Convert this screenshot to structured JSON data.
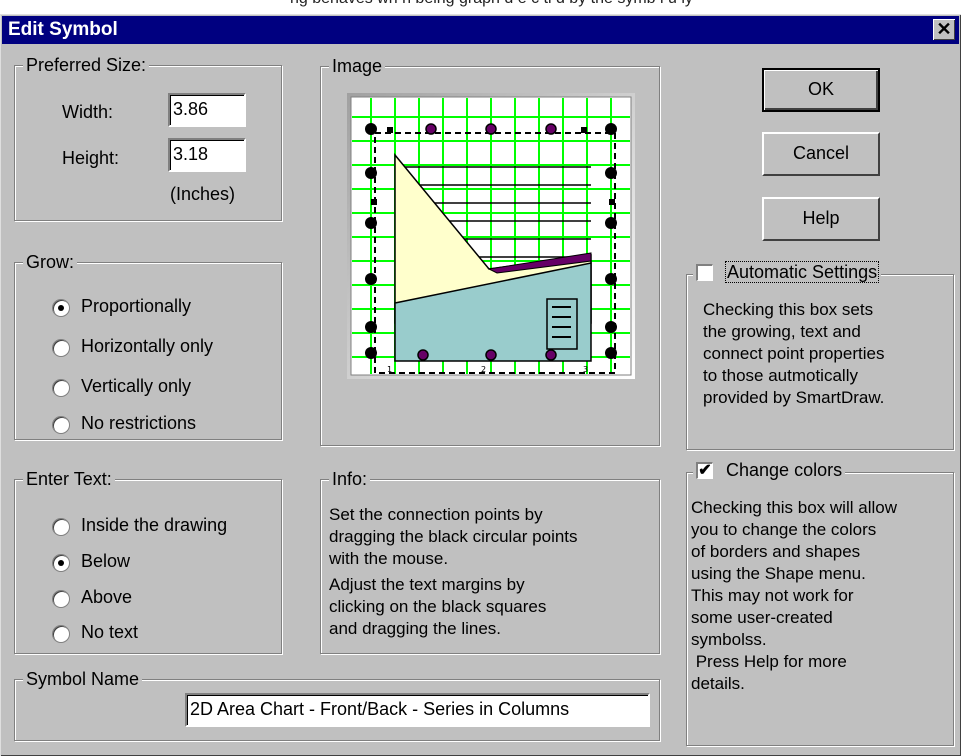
{
  "background_text": "ng behaves wh n being graph d          e     c ti     d by the symb l     u   ly",
  "window": {
    "title": "Edit Symbol",
    "close": "✕"
  },
  "preferred_size": {
    "legend": "Preferred Size:",
    "width_label": "Width:",
    "width_value": "3.86",
    "height_label": "Height:",
    "height_value": "3.18",
    "units": "(Inches)"
  },
  "grow": {
    "legend": "Grow:",
    "options": [
      {
        "label": "Proportionally",
        "selected": true
      },
      {
        "label": "Horizontally only",
        "selected": false
      },
      {
        "label": "Vertically only",
        "selected": false
      },
      {
        "label": "No restrictions",
        "selected": false
      }
    ]
  },
  "enter_text": {
    "legend": "Enter Text:",
    "options": [
      {
        "label": "Inside the drawing",
        "selected": false
      },
      {
        "label": "Below",
        "selected": true
      },
      {
        "label": "Above",
        "selected": false
      },
      {
        "label": "No text",
        "selected": false
      }
    ]
  },
  "symbol_name": {
    "legend": "Symbol Name",
    "value": "2D Area Chart - Front/Back - Series in Columns"
  },
  "image": {
    "legend": "Image",
    "colors": {
      "grid": "#00ff00",
      "area_back": "#ffffcc",
      "area_front": "#99cccc",
      "series": "#660066"
    }
  },
  "info": {
    "legend": "Info:",
    "lines": [
      "Set the connection points by",
      "dragging the black circular points",
      "with the mouse.",
      "Adjust the text margins by",
      "clicking on the black squares",
      "and dragging the lines."
    ]
  },
  "buttons": {
    "ok": "OK",
    "cancel": "Cancel",
    "help": "Help"
  },
  "auto_settings": {
    "label": "Automatic Settings",
    "checked": false,
    "lines": [
      "Checking this box sets",
      "the growing, text and",
      "connect point properties",
      "to those autmotically",
      "provided by SmartDraw."
    ]
  },
  "change_colors": {
    "label": "Change colors",
    "checked": true,
    "check_mark": "✔",
    "lines": [
      "Checking this box will allow",
      "you to change the colors",
      "of borders and shapes",
      "using the Shape menu.",
      "This may not work for",
      "some user-created",
      "symbolss.",
      " Press Help for more",
      "details."
    ]
  }
}
